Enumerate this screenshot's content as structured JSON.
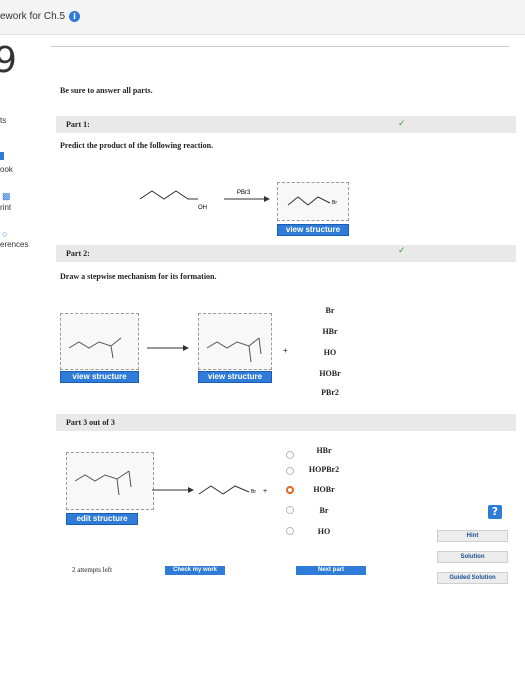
{
  "header": {
    "title": "ework for Ch.5",
    "info_icon": "info-icon"
  },
  "question_number": "9",
  "sidebar": {
    "items": [
      {
        "label": "ts"
      },
      {
        "label": "ook"
      },
      {
        "label": "rint"
      },
      {
        "label": "erences"
      }
    ]
  },
  "instructions": "Be sure to answer all parts.",
  "part1": {
    "title": "Part 1:",
    "prompt": "Predict the product of the following reaction.",
    "reagent": "PBr3",
    "substituent_oh": "OH",
    "product_br": "Br",
    "view_label": "view structure",
    "status": "correct"
  },
  "part2": {
    "title": "Part 2:",
    "prompt": "Draw a stepwise mechanism for its formation.",
    "view_label_1": "view structure",
    "view_label_2": "view structure",
    "plus": "+",
    "options": [
      "Br",
      "HBr",
      "HO",
      "HOBr",
      "PBr2"
    ],
    "status": "correct"
  },
  "part3": {
    "title": "Part 3 out of 3",
    "edit_label": "edit structure",
    "br_label": "Br",
    "plus": "+",
    "options": [
      "HBr",
      "HOPBr2",
      "HOBr",
      "Br",
      "HO"
    ],
    "selected_option": "HOBr"
  },
  "footer": {
    "attempts": "2 attempts left",
    "check_label": "Check my work",
    "next_label": "Next part"
  },
  "right_buttons": {
    "help": "?",
    "hint": "Hint",
    "solution": "Solution",
    "guided": "Guided Solution"
  },
  "colors": {
    "accent": "#2f7bd8",
    "correct": "#3c9b3c",
    "selected_radio": "#e06a1a"
  }
}
